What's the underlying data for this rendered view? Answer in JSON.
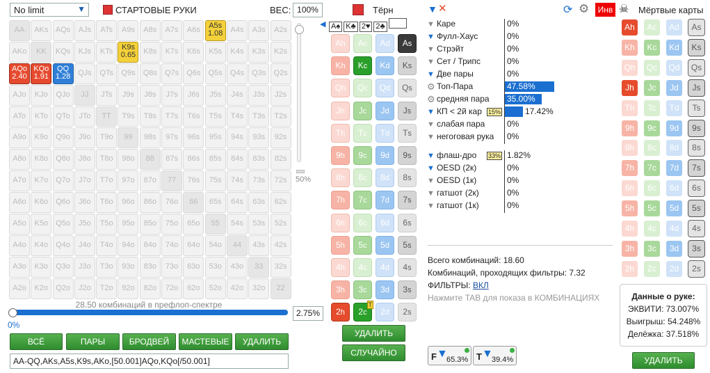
{
  "toolbar": {
    "limit_select": "No limit",
    "starting_hands_label": "СТАРТОВЫЕ РУКИ",
    "weight_label": "ВЕС:",
    "weight_value": "100%",
    "turn_label": "Тёрн",
    "board": [
      "A♠",
      "K♣",
      "2♥",
      "2♣"
    ],
    "inv_label": "Инв",
    "dead_cards_label": "Мёртвые карты"
  },
  "range_grid": [
    [
      "AA",
      "AKs",
      "AQs",
      "AJs",
      "ATs",
      "A9s",
      "A8s",
      "A7s",
      "A6s",
      "A5s",
      "A4s",
      "A3s",
      "A2s"
    ],
    [
      "AKo",
      "KK",
      "KQs",
      "KJs",
      "KTs",
      "K9s",
      "K8s",
      "K7s",
      "K6s",
      "K5s",
      "K4s",
      "K3s",
      "K2s"
    ],
    [
      "AQo",
      "KQo",
      "QQ",
      "QJs",
      "QTs",
      "Q9s",
      "Q8s",
      "Q7s",
      "Q6s",
      "Q5s",
      "Q4s",
      "Q3s",
      "Q2s"
    ],
    [
      "AJo",
      "KJo",
      "QJo",
      "JJ",
      "JTs",
      "J9s",
      "J8s",
      "J7s",
      "J6s",
      "J5s",
      "J4s",
      "J3s",
      "J2s"
    ],
    [
      "ATo",
      "KTo",
      "QTo",
      "JTo",
      "TT",
      "T9s",
      "T8s",
      "T7s",
      "T6s",
      "T5s",
      "T4s",
      "T3s",
      "T2s"
    ],
    [
      "A9o",
      "K9o",
      "Q9o",
      "J9o",
      "T9o",
      "99",
      "98s",
      "97s",
      "96s",
      "95s",
      "94s",
      "93s",
      "92s"
    ],
    [
      "A8o",
      "K8o",
      "Q8o",
      "J8o",
      "T8o",
      "98o",
      "88",
      "87s",
      "86s",
      "85s",
      "84s",
      "83s",
      "82s"
    ],
    [
      "A7o",
      "K7o",
      "Q7o",
      "J7o",
      "T7o",
      "97o",
      "87o",
      "77",
      "76s",
      "75s",
      "74s",
      "73s",
      "72s"
    ],
    [
      "A6o",
      "K6o",
      "Q6o",
      "J6o",
      "T6o",
      "96o",
      "86o",
      "76o",
      "66",
      "65s",
      "64s",
      "63s",
      "62s"
    ],
    [
      "A5o",
      "K5o",
      "Q5o",
      "J5o",
      "T5o",
      "95o",
      "85o",
      "75o",
      "65o",
      "55",
      "54s",
      "53s",
      "52s"
    ],
    [
      "A4o",
      "K4o",
      "Q4o",
      "J4o",
      "T4o",
      "94o",
      "84o",
      "74o",
      "64o",
      "54o",
      "44",
      "43s",
      "42s"
    ],
    [
      "A3o",
      "K3o",
      "Q3o",
      "J3o",
      "T3o",
      "93o",
      "83o",
      "73o",
      "63o",
      "53o",
      "43o",
      "33",
      "32s"
    ],
    [
      "A2o",
      "K2o",
      "Q2o",
      "J2o",
      "T2o",
      "92o",
      "82o",
      "72o",
      "62o",
      "52o",
      "42o",
      "32o",
      "22"
    ]
  ],
  "selected_hands": {
    "A5s": {
      "style": "y",
      "w": "1.08"
    },
    "K9s": {
      "style": "y",
      "w": "0.65"
    },
    "AQo": {
      "style": "r",
      "w": "2.40"
    },
    "KQo": {
      "style": "r",
      "w": "1.91"
    },
    "QQ": {
      "style": "b",
      "w": "1.28"
    }
  },
  "slider": {
    "vertical_value": "50%",
    "combos_text": "28.50 комбинаций в префлоп-спектре",
    "zero": "0%",
    "percent": "2.75%"
  },
  "range_buttons": [
    "ВСЁ",
    "ПАРЫ",
    "БРОДВЕЙ",
    "МАСТЕВЫЕ",
    "УДАЛИТЬ"
  ],
  "range_text": "AA-QQ,AKs,A5s,K9s,AKo,[50.001]AQo,KQo[/50.001]",
  "turn_cards": {
    "ranks": [
      "A",
      "K",
      "Q",
      "J",
      "T",
      "9",
      "8",
      "7",
      "6",
      "5",
      "4",
      "3",
      "2"
    ],
    "suits": [
      "h",
      "c",
      "d",
      "s"
    ]
  },
  "turn_buttons": {
    "delete": "УДАЛИТЬ",
    "random": "СЛУЧАЙНО"
  },
  "stats": [
    {
      "label": "Каре",
      "value": "0%",
      "on": false
    },
    {
      "label": "Фулл-Хаус",
      "value": "0%",
      "on": true
    },
    {
      "label": "Стрэйт",
      "value": "0%",
      "on": false
    },
    {
      "label": "Сет / Трипс",
      "value": "0%",
      "on": false
    },
    {
      "label": "Две пары",
      "value": "0%",
      "on": true
    },
    {
      "label": "Топ-Пара",
      "value": "47.58%",
      "on": false,
      "gear": true,
      "bar": 0.4758
    },
    {
      "label": "средняя пара",
      "value": "35.00%",
      "on": false,
      "gear": true,
      "bar": 0.35
    },
    {
      "label": "КП < 2й кар",
      "value": "17.42%",
      "on": true,
      "tag": "15%",
      "bar": 0.1742
    },
    {
      "label": "слабая пара",
      "value": "0%",
      "on": false
    },
    {
      "label": "негоговая рука",
      "value": "0%",
      "on": false
    }
  ],
  "draws": [
    {
      "label": "флаш-дро",
      "value": "1.82%",
      "on": true,
      "tag": "33%"
    },
    {
      "label": "OESD (2к)",
      "value": "0%",
      "on": true
    },
    {
      "label": "OESD (1к)",
      "value": "0%",
      "on": false
    },
    {
      "label": "гатшот (2к)",
      "value": "0%",
      "on": false
    },
    {
      "label": "гатшот (1к)",
      "value": "0%",
      "on": false
    }
  ],
  "summary": {
    "total": "Всего комбинаций: 18.60",
    "passing": "Комбинаций, проходящих фильтры: 7.32",
    "filters_label": "ФИЛЬТРЫ:",
    "filters_value": "ВКЛ",
    "tab_hint": "Нажмите TAB для показа в КОМБИНАЦИЯХ"
  },
  "indicators": [
    {
      "letter": "F",
      "value": "65.3%"
    },
    {
      "letter": "T",
      "value": "39.4%"
    }
  ],
  "hand_data": {
    "title": "Данные о руке:",
    "equity": "ЭКВИТИ: 73.007%",
    "win": "Выигрыш: 54.248%",
    "tie": "Делёжка: 37.518%"
  },
  "dead_delete": "УДАЛИТЬ",
  "colors": {
    "accent": "#1a6fd0",
    "green": "#2f8d2f",
    "red": "#e54b2c"
  }
}
